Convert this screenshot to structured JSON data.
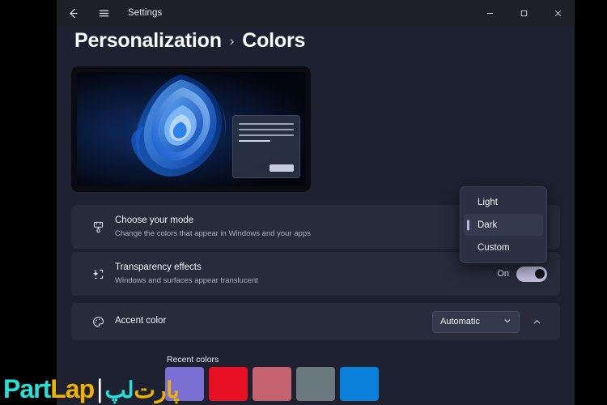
{
  "titlebar": {
    "back_icon": "back-arrow-icon",
    "menu_icon": "hamburger-icon",
    "app_title": "Settings",
    "minimize_label": "—",
    "maximize_label": "□",
    "close_label": "✕"
  },
  "breadcrumb": {
    "parent": "Personalization",
    "separator": "›",
    "current": "Colors"
  },
  "preview": {
    "name": "colors-preview",
    "wallpaper": "windows-11-bloom"
  },
  "rows": {
    "mode": {
      "icon": "paintbrush-icon",
      "title": "Choose your mode",
      "subtitle": "Change the colors that appear in Windows and your apps"
    },
    "transparency": {
      "icon": "transparency-sparkle-icon",
      "title": "Transparency effects",
      "subtitle": "Windows and surfaces appear translucent",
      "toggle_state": "On",
      "toggle_on": true
    },
    "accent": {
      "icon": "palette-icon",
      "title": "Accent color",
      "select_value": "Automatic",
      "select_chevron": "chevron-down-icon",
      "expander_chevron": "chevron-up-icon"
    }
  },
  "mode_flyout": {
    "items": [
      {
        "label": "Light",
        "selected": false
      },
      {
        "label": "Dark",
        "selected": true
      },
      {
        "label": "Custom",
        "selected": false
      }
    ]
  },
  "recent_colors": {
    "label": "Recent colors",
    "swatches": [
      {
        "name": "purple",
        "hex": "#7b6fd4"
      },
      {
        "name": "red",
        "hex": "#e81123"
      },
      {
        "name": "rose",
        "hex": "#c4636f"
      },
      {
        "name": "slate",
        "hex": "#69797e"
      },
      {
        "name": "blue",
        "hex": "#0b80da"
      }
    ]
  },
  "watermark": {
    "part": "Part",
    "lap": "Lap",
    "bar": "|",
    "fa_lap": "لپ",
    "fa_part": "پارت"
  },
  "colors": {
    "page_bg": "#1d2130",
    "titlebar_bg": "#1e2028",
    "card_bg": "#272b3a",
    "flyout_bg": "#2b3042",
    "toggle_track": "#c3c0e0",
    "text_primary": "#f2f4f9",
    "text_secondary": "#a9b0c2"
  }
}
